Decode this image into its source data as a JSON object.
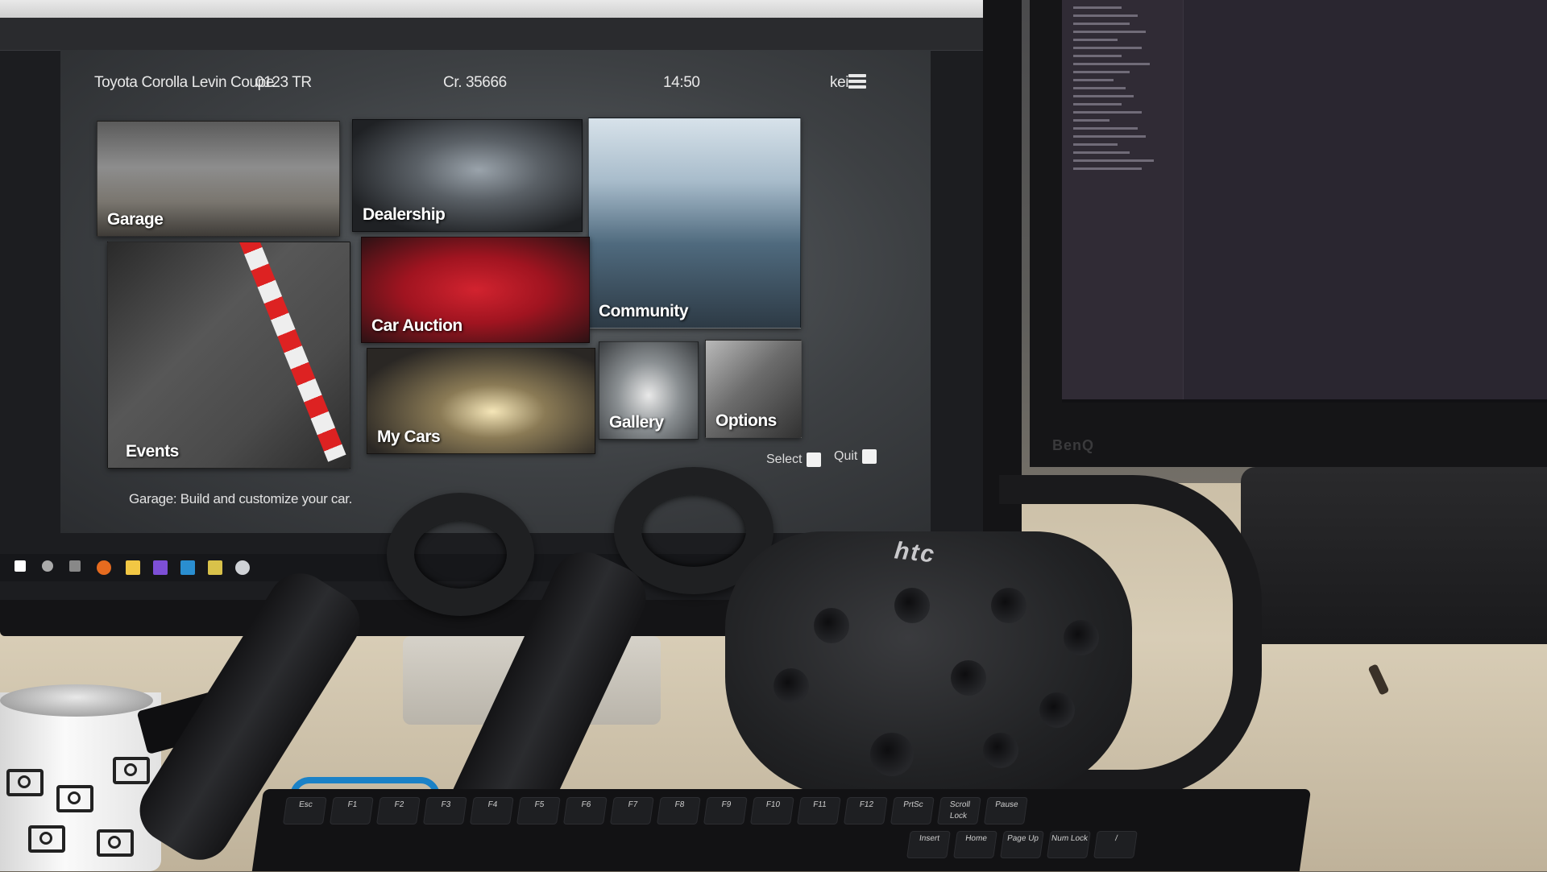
{
  "hud": {
    "car_name": "Toyota Corolla Levin Coupe",
    "plate": "0123 TR",
    "credits": "Cr. 35666",
    "time": "14:50",
    "user": "kei"
  },
  "tiles": {
    "garage": "Garage",
    "dealership": "Dealership",
    "community": "Community",
    "events": "Events",
    "car_auction": "Car Auction",
    "my_cars": "My Cars",
    "gallery": "Gallery",
    "options": "Options"
  },
  "buttons": {
    "select": "Select",
    "quit": "Quit"
  },
  "status": "Garage: Build and customize your car.",
  "hardware": {
    "headset_logo": "htc",
    "monitor_brand": "BenQ"
  },
  "keyboard": {
    "keys": [
      "Esc",
      "F1",
      "F2",
      "F3",
      "F4",
      "F5",
      "F6",
      "F7",
      "F8",
      "F9",
      "F10",
      "F11",
      "F12",
      "PrtSc",
      "Scroll Lock",
      "Pause"
    ],
    "lower_keys": [
      "Insert",
      "Home",
      "Page Up",
      "Num Lock",
      "/"
    ]
  },
  "colors": {
    "desk": "#d8cdb6",
    "vive_black": "#1d1e20",
    "cable_blue": "#1b82c7"
  }
}
